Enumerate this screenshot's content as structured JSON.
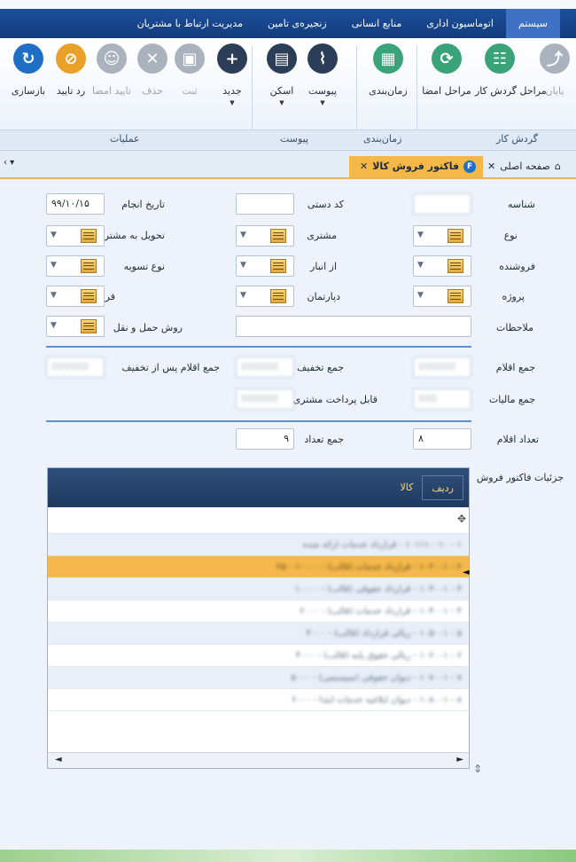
{
  "menu": {
    "items": [
      {
        "label": "سیستم",
        "active": false
      },
      {
        "label": "اتوماسیون اداری",
        "active": false
      },
      {
        "label": "منابع انسانی",
        "active": false
      },
      {
        "label": "زنجیره‌ی تامین",
        "active": false
      },
      {
        "label": "مدیریت ارتباط با مشتریان",
        "active": false
      }
    ]
  },
  "ribbon": {
    "workflow": {
      "group_label": "گردش کار",
      "buttons": [
        {
          "label": "پایان",
          "icon": "workflow-end-icon",
          "color": "#aab2bd",
          "disabled": true
        },
        {
          "label": "مراحل گردش کار",
          "icon": "workflow-tree-icon",
          "color": "#3aa37a",
          "disabled": false
        },
        {
          "label": "مراحل امضا",
          "icon": "signature-steps-icon",
          "color": "#3aa37a",
          "disabled": false
        }
      ]
    },
    "scheduling": {
      "group_label": "زمان‌بندی",
      "buttons": [
        {
          "label": "زمان‌بندی",
          "icon": "calendar-icon",
          "color": "#3aa37a",
          "disabled": false
        }
      ]
    },
    "attachment": {
      "group_label": "پیوست",
      "buttons": [
        {
          "label": "پیوست",
          "icon": "paperclip-icon",
          "color": "#2c3e57",
          "disabled": false
        },
        {
          "label": "اسکن",
          "icon": "scanner-icon",
          "color": "#2c3e57",
          "disabled": false
        }
      ]
    },
    "operations": {
      "group_label": "عملیات",
      "buttons": [
        {
          "label": "جدید",
          "icon": "plus-icon",
          "color": "#2c3e57",
          "disabled": false
        },
        {
          "label": "ثبت",
          "icon": "save-icon",
          "color": "#aab2bd",
          "disabled": true
        },
        {
          "label": "حذف",
          "icon": "delete-icon",
          "color": "#aab2bd",
          "disabled": true
        },
        {
          "label": "تایید امضا",
          "icon": "user-approve-icon",
          "color": "#aab2bd",
          "disabled": true
        },
        {
          "label": "رد تایید",
          "icon": "reject-approval-icon",
          "color": "#e9a12a",
          "disabled": false
        },
        {
          "label": "بازسازی",
          "icon": "refresh-icon",
          "color": "#1f6fc5",
          "disabled": false
        }
      ]
    }
  },
  "tabs": [
    {
      "label": "صفحه اصلی",
      "active": false,
      "icon": "home-icon"
    },
    {
      "label": "فاکتور فروش کالا",
      "active": true,
      "icon": "invoice-icon"
    }
  ],
  "form": {
    "col_right": [
      {
        "label": "شناسه",
        "value": "",
        "kind": "input"
      },
      {
        "label": "نوع",
        "value": "",
        "kind": "combo"
      },
      {
        "label": "فروشنده",
        "value": "",
        "kind": "combo"
      },
      {
        "label": "پروژه",
        "value": "",
        "kind": "combo"
      },
      {
        "label": "ملاحظات",
        "value": "",
        "kind": "wide"
      }
    ],
    "col_mid": [
      {
        "label": "کد دستی",
        "value": "",
        "kind": "input"
      },
      {
        "label": "مشتری",
        "value": "",
        "kind": "combo"
      },
      {
        "label": "از انبار",
        "value": "",
        "kind": "combo"
      },
      {
        "label": "دپارتمان",
        "value": "",
        "kind": "combo"
      }
    ],
    "col_left": [
      {
        "label": "تاریخ انجام",
        "value": "۹۹/۱۰/۱۵",
        "kind": "input"
      },
      {
        "label": "تحویل به مشتری",
        "value": "",
        "kind": "combo"
      },
      {
        "label": "نوع تسویه",
        "value": "",
        "kind": "combo"
      },
      {
        "label": "فرم",
        "value": "",
        "kind": "combo"
      },
      {
        "label": "روش حمل و نقل",
        "value": "",
        "kind": "combo"
      }
    ],
    "totals": {
      "items_sum_label": "جمع اقلام",
      "discount_sum_label": "جمع تخفیف",
      "items_after_discount_label": "جمع اقلام پس از تخفیف",
      "tax_sum_label": "جمع مالیات",
      "customer_prepay_label": "قابل پرداخت مشتری",
      "item_count_label": "تعداد اقلام",
      "item_count_value": "۸",
      "qty_sum_label": "جمع تعداد",
      "qty_sum_value": "۹"
    }
  },
  "details": {
    "label": "جزئیات فاکتور فروش",
    "columns": [
      "ردیف",
      "کالا"
    ],
    "rows": [
      {
        "text": "۱ - ۱۰۱۱۱۰۰۱۰ - قرارداد خدمات ارائه شده",
        "selected": false
      },
      {
        "text": "۲ - ۱۰۲۰۰۱ - قرارداد خدمات (قالب) - ۲۵۰۰۱۰۰۰۰",
        "selected": true
      },
      {
        "text": "۳ - ۱۰۳۰۰۱ - قرارداد حقوقی (قالب) - ۱۰۰۰۰",
        "selected": false
      },
      {
        "text": "۴ - ۱۰۴۰۰۱ - قرارداد خدمات (قالب) - ۲۰۰۰",
        "selected": false
      },
      {
        "text": "۵ - ۱۰۵۰۰۱ - ریالی قرارداد (قالب) - ۳۰۰۰",
        "selected": false
      },
      {
        "text": "۶ - ۱۰۶۰۰۱ - ریالی حقوق پایه (قالب) - ۴۰۰۰",
        "selected": false
      },
      {
        "text": "۷ - ۱۰۷۰۰۱ - دیوان حقوقی (سیستمی) - ۵۰۰۰",
        "selected": false
      },
      {
        "text": "۸ - ۱۰۸۰۰۱ - دیوان ابلاغیه خدمات ابتدا - ۶۰۰۰",
        "selected": false
      }
    ]
  }
}
